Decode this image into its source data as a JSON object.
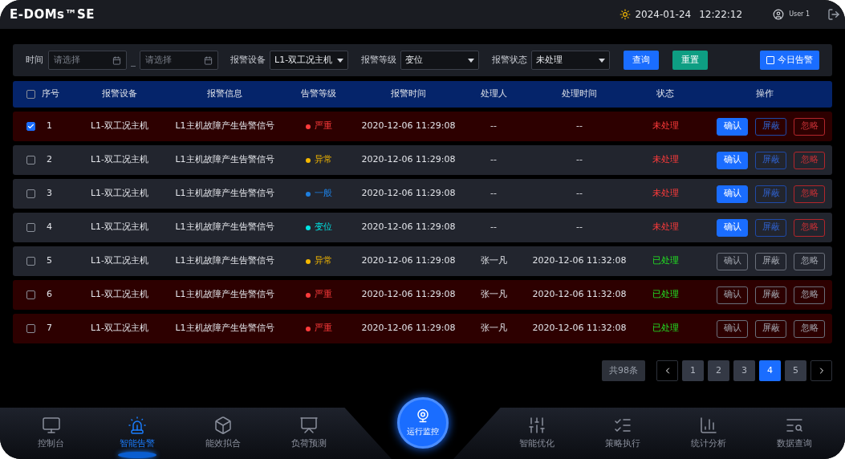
{
  "header": {
    "logo": "E-DOMs™SE",
    "date": "2024-01-24",
    "time": "12:22:12",
    "user": "User 1"
  },
  "filters": {
    "time_label": "时间",
    "start_placeholder": "请选择",
    "end_placeholder": "请选择",
    "device": {
      "label": "报警设备",
      "value": "L1-双工况主机"
    },
    "level": {
      "label": "报警等级",
      "value": "变位"
    },
    "status": {
      "label": "报警状态",
      "value": "未处理"
    },
    "buttons": [
      {
        "label": "查询",
        "kind": "primary"
      },
      {
        "label": "重置",
        "kind": "reset"
      }
    ],
    "today": {
      "label": "今日告警",
      "checked": false
    }
  },
  "table": {
    "select_all": false,
    "columns": [
      "序号",
      "报警设备",
      "报警信息",
      "告警等级",
      "报警时间",
      "处理人",
      "处理时间",
      "状态",
      "操作"
    ],
    "rows": [
      {
        "no": "1",
        "checked": true,
        "device": "L1-双工况主机",
        "info": "L1主机故障产生告警信号",
        "level": {
          "label": "严重",
          "kind": "severe",
          "color": "#ff3b3b"
        },
        "time": "2020-12-06 11:29:08",
        "handler": "--",
        "handled_time": "--",
        "status": {
          "label": "未处理",
          "kind": "pending"
        },
        "actions": [
          "确认",
          "屏蔽",
          "忽略"
        ]
      },
      {
        "no": "2",
        "checked": false,
        "device": "L1-双工况主机",
        "info": "L1主机故障产生告警信号",
        "level": {
          "label": "异常",
          "kind": "abnormal",
          "color": "#f5b800"
        },
        "time": "2020-12-06 11:29:08",
        "handler": "--",
        "handled_time": "--",
        "status": {
          "label": "未处理",
          "kind": "pending"
        },
        "actions": [
          "确认",
          "屏蔽",
          "忽略"
        ]
      },
      {
        "no": "3",
        "checked": false,
        "device": "L1-双工况主机",
        "info": "L1主机故障产生告警信号",
        "level": {
          "label": "一般",
          "kind": "normal",
          "color": "#1e7fe0"
        },
        "time": "2020-12-06 11:29:08",
        "handler": "--",
        "handled_time": "--",
        "status": {
          "label": "未处理",
          "kind": "pending"
        },
        "actions": [
          "确认",
          "屏蔽",
          "忽略"
        ]
      },
      {
        "no": "4",
        "checked": false,
        "device": "L1-双工况主机",
        "info": "L1主机故障产生告警信号",
        "level": {
          "label": "变位",
          "kind": "shift",
          "color": "#00e5e5"
        },
        "time": "2020-12-06 11:29:08",
        "handler": "--",
        "handled_time": "--",
        "status": {
          "label": "未处理",
          "kind": "pending"
        },
        "actions": [
          "确认",
          "屏蔽",
          "忽略"
        ]
      },
      {
        "no": "5",
        "checked": false,
        "device": "L1-双工况主机",
        "info": "L1主机故障产生告警信号",
        "level": {
          "label": "异常",
          "kind": "abnormal",
          "color": "#f5b800"
        },
        "time": "2020-12-06 11:29:08",
        "handler": "张一凡",
        "handled_time": "2020-12-06 11:32:08",
        "status": {
          "label": "已处理",
          "kind": "handled"
        },
        "actions": [
          "确认",
          "屏蔽",
          "忽略"
        ]
      },
      {
        "no": "6",
        "checked": false,
        "device": "L1-双工况主机",
        "info": "L1主机故障产生告警信号",
        "level": {
          "label": "严重",
          "kind": "severe",
          "color": "#ff3b3b"
        },
        "time": "2020-12-06 11:29:08",
        "handler": "张一凡",
        "handled_time": "2020-12-06 11:32:08",
        "status": {
          "label": "已处理",
          "kind": "handled"
        },
        "actions": [
          "确认",
          "屏蔽",
          "忽略"
        ]
      },
      {
        "no": "7",
        "checked": false,
        "device": "L1-双工况主机",
        "info": "L1主机故障产生告警信号",
        "level": {
          "label": "严重",
          "kind": "severe",
          "color": "#ff3b3b"
        },
        "time": "2020-12-06 11:29:08",
        "handler": "张一凡",
        "handled_time": "2020-12-06 11:32:08",
        "status": {
          "label": "已处理",
          "kind": "handled"
        },
        "actions": [
          "确认",
          "屏蔽",
          "忽略"
        ]
      }
    ]
  },
  "pagination": {
    "total": "共98条",
    "pages": [
      {
        "label": "1",
        "selected": false
      },
      {
        "label": "2",
        "selected": false
      },
      {
        "label": "3",
        "selected": false
      },
      {
        "label": "4",
        "selected": true
      },
      {
        "label": "5",
        "selected": false
      }
    ]
  },
  "nav": {
    "left": [
      {
        "label": "控制台",
        "kind": "console",
        "selected": false
      },
      {
        "label": "智能告警",
        "kind": "alarm",
        "selected": true
      },
      {
        "label": "能效拟合",
        "kind": "fit",
        "selected": false
      },
      {
        "label": "负荷预测",
        "kind": "forecast",
        "selected": false
      }
    ],
    "center": {
      "label": "运行监控"
    },
    "right": [
      {
        "label": "智能优化",
        "kind": "optimize",
        "selected": false
      },
      {
        "label": "策略执行",
        "kind": "strategy",
        "selected": false
      },
      {
        "label": "统计分析",
        "kind": "stats",
        "selected": false
      },
      {
        "label": "数据查询",
        "kind": "query",
        "selected": false
      }
    ]
  }
}
